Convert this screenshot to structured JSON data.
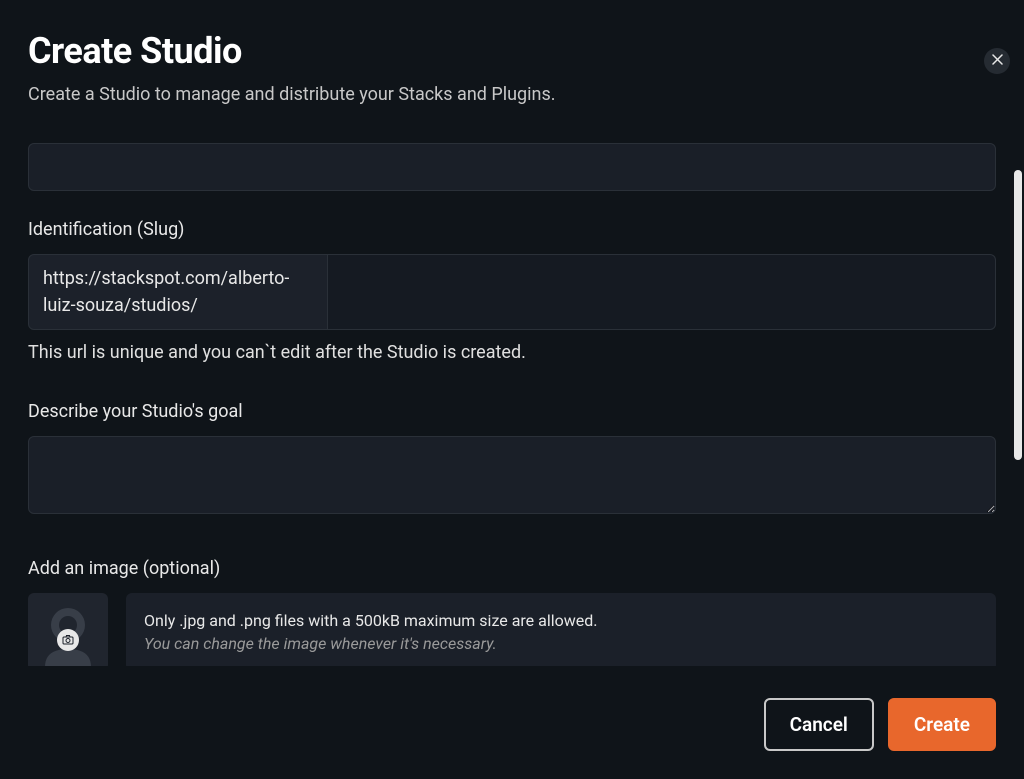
{
  "modal": {
    "title": "Create Studio",
    "subtitle": "Create a Studio to manage and distribute your Stacks and Plugins."
  },
  "form": {
    "name_value": "",
    "slug": {
      "label": "Identification (Slug)",
      "prefix": "https://stackspot.com/alberto-luiz-souza/studios/",
      "value": "",
      "helper": "This url is unique and you can`t edit after the Studio is created."
    },
    "description": {
      "label": "Describe your Studio's goal",
      "value": ""
    },
    "image": {
      "label": "Add an image (optional)",
      "info_main": "Only .jpg and .png files with a 500kB maximum size are allowed.",
      "info_sub": "You can change the image whenever it's necessary."
    }
  },
  "buttons": {
    "cancel": "Cancel",
    "create": "Create"
  }
}
